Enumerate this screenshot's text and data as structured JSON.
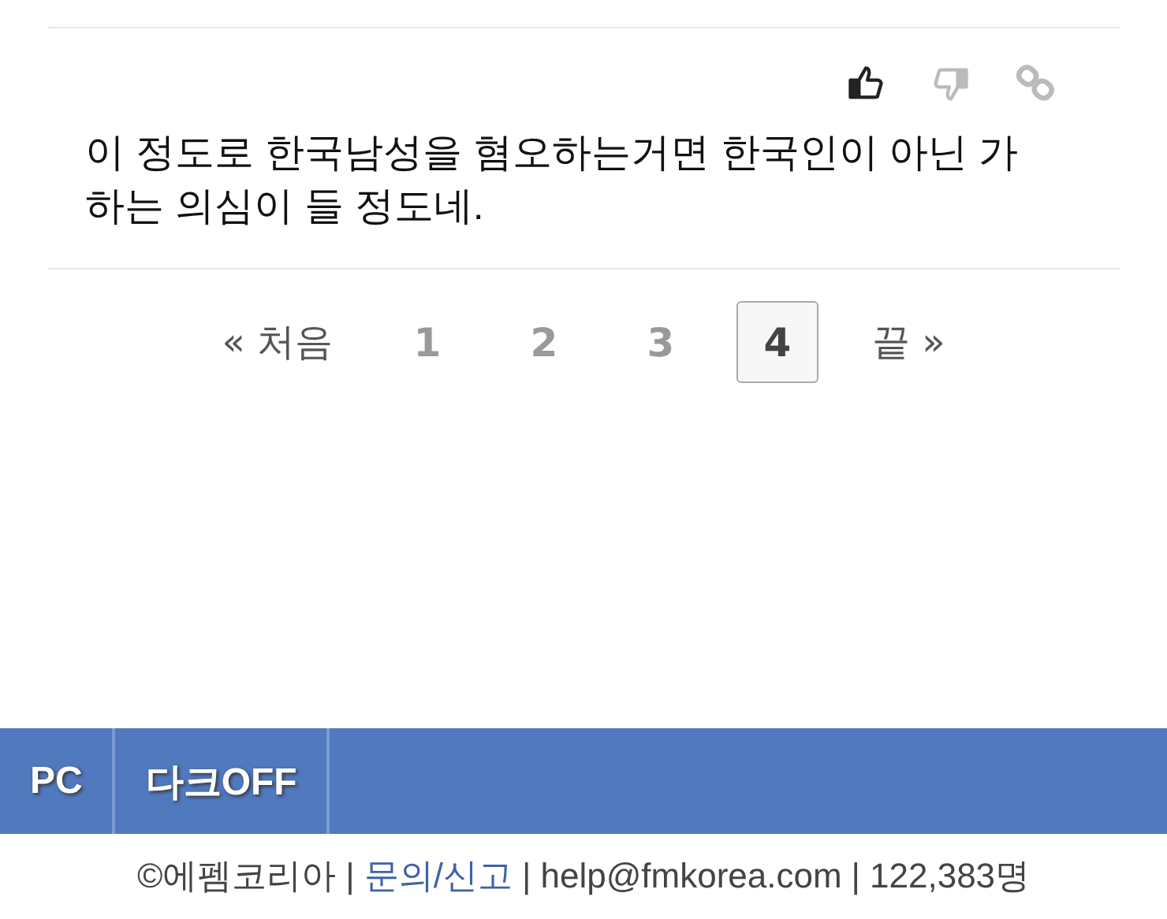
{
  "comment": {
    "actions": [
      {
        "kind": "like",
        "active": true
      },
      {
        "kind": "dislike",
        "active": false
      },
      {
        "kind": "link",
        "active": false
      }
    ],
    "text": "이 정도로 한국남성을 혐오하는거면 한국인이 아닌 가하는 의심이 들 정도네."
  },
  "pagination": {
    "first": "« 처음",
    "pages": [
      {
        "label": "1",
        "selected": false
      },
      {
        "label": "2",
        "selected": false
      },
      {
        "label": "3",
        "selected": false
      },
      {
        "label": "4",
        "selected": true
      }
    ],
    "last": "끝 »"
  },
  "bottom_bar": {
    "buttons": [
      "PC",
      "다크OFF"
    ]
  },
  "footer": [
    {
      "kind": "text",
      "text": "©에펨코리아"
    },
    {
      "kind": "separator",
      "text": "|"
    },
    {
      "kind": "link",
      "text": "문의/신고"
    },
    {
      "kind": "separator",
      "text": "|"
    },
    {
      "kind": "text",
      "text": "help@fmkorea.com"
    },
    {
      "kind": "separator",
      "text": "|"
    },
    {
      "kind": "text",
      "text": "122,383명"
    }
  ]
}
